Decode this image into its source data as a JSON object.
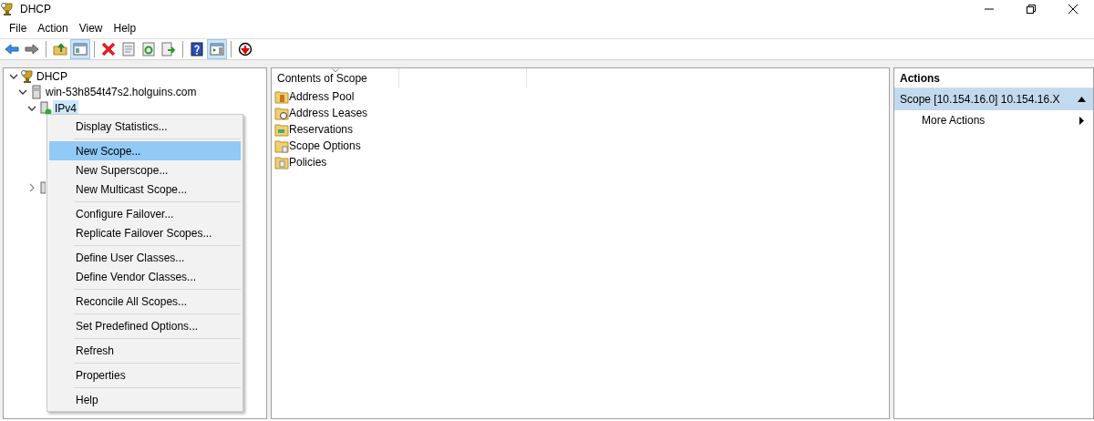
{
  "window": {
    "title": "DHCP"
  },
  "menu_bar": [
    "File",
    "Action",
    "View",
    "Help"
  ],
  "toolbar_groups": [
    [
      {
        "pressed": false
      },
      {
        "pressed": false
      }
    ],
    [
      {
        "pressed": false
      },
      {
        "pressed": true
      }
    ],
    [
      {
        "pressed": false
      },
      {
        "pressed": false
      },
      {
        "pressed": false
      },
      {
        "pressed": false
      }
    ],
    [
      {
        "pressed": false
      },
      {
        "pressed": true
      }
    ],
    [
      {
        "pressed": false
      }
    ]
  ],
  "tree": [
    {
      "label": "DHCP",
      "expanded": true,
      "selected": false,
      "children": [
        {
          "label": "win-53h854t47s2.holguins.com",
          "expanded": true,
          "selected": false,
          "children": [
            {
              "label": "IPv4",
              "expanded": true,
              "selected": true
            },
            {
              "expanded": false,
              "selected": false
            }
          ]
        }
      ]
    }
  ],
  "context_menu": [
    [
      {
        "label": "Display Statistics...",
        "selected": false
      }
    ],
    [
      {
        "label": "New Scope...",
        "selected": true
      },
      {
        "label": "New Superscope...",
        "selected": false
      },
      {
        "label": "New Multicast Scope...",
        "selected": false
      }
    ],
    [
      {
        "label": "Configure Failover...",
        "selected": false
      },
      {
        "label": "Replicate Failover Scopes...",
        "selected": false
      }
    ],
    [
      {
        "label": "Define User Classes...",
        "selected": false
      },
      {
        "label": "Define Vendor Classes...",
        "selected": false
      }
    ],
    [
      {
        "label": "Reconcile All Scopes...",
        "selected": false
      }
    ],
    [
      {
        "label": "Set Predefined Options...",
        "selected": false
      }
    ],
    [
      {
        "label": "Refresh",
        "selected": false
      }
    ],
    [
      {
        "label": "Properties",
        "selected": false
      }
    ],
    [
      {
        "label": "Help",
        "selected": false
      }
    ]
  ],
  "content": {
    "columns": [
      "Contents of Scope"
    ],
    "rows": [
      "Address Pool",
      "Address Leases",
      "Reservations",
      "Scope Options",
      "Policies"
    ]
  },
  "actions": {
    "title": "Actions",
    "section": {
      "label": "Scope [10.154.16.0] 10.154.16.X",
      "expanded": true
    },
    "items": [
      "More Actions"
    ]
  }
}
